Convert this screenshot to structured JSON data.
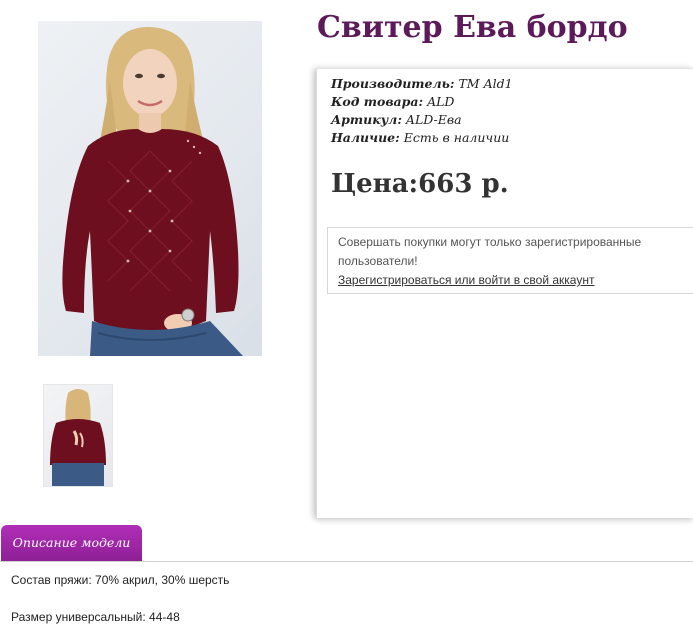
{
  "product": {
    "title": "Свитер Ева бордо",
    "attributes": [
      {
        "key": "Производитель:",
        "value": "ТМ Ald1"
      },
      {
        "key": "Код товара:",
        "value": "ALD"
      },
      {
        "key": "Артикул:",
        "value": "ALD-Ева"
      },
      {
        "key": "Наличие:",
        "value": "Есть в наличии"
      }
    ],
    "price": "Цена:663 р.",
    "notice": {
      "text": "Совершать покупки могут только зарегистрированные пользователи!",
      "link": "Зарегистрироваться или войти в свой аккаунт"
    }
  },
  "tabs": {
    "active_label": "Описание модели"
  },
  "description": {
    "lines": [
      "Состав пряжи: 70% акрил, 30% шерсть",
      "Размер универсальный: 44-48"
    ]
  },
  "colors": {
    "title": "#5c1a5a",
    "tab": "#9d27a5",
    "sweater": "#6d0f1e"
  },
  "images": {
    "main": "product-photo-front",
    "thumb": "product-photo-back"
  }
}
